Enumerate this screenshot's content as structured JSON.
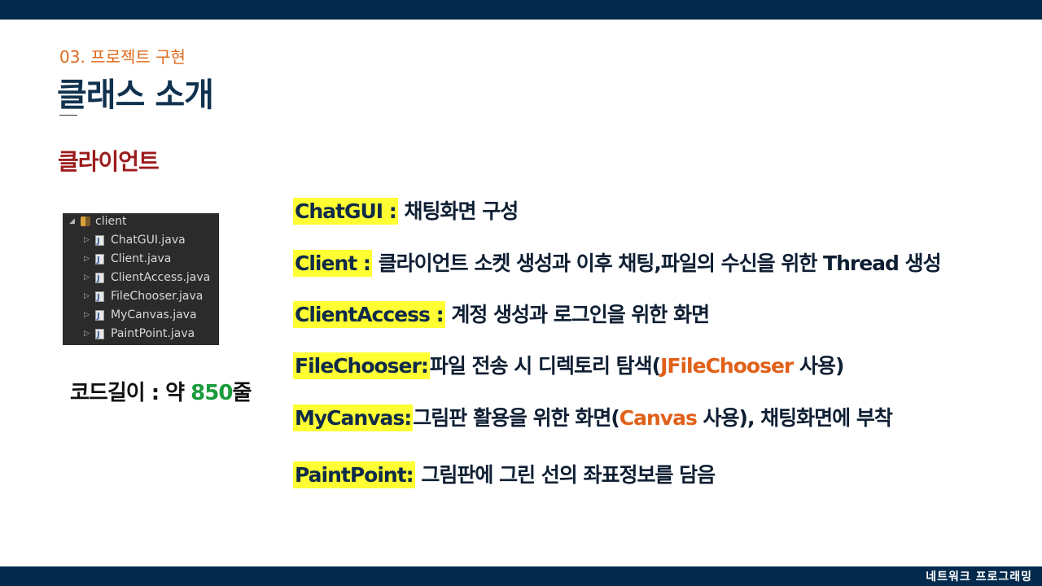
{
  "header": {
    "section_label": "03. 프로젝트 구현",
    "title": "클래스 소개"
  },
  "subsection": "클라이언트",
  "tree": {
    "root": "client",
    "files": [
      "ChatGUI.java",
      "Client.java",
      "ClientAccess.java",
      "FileChooser.java",
      "MyCanvas.java",
      "PaintPoint.java"
    ]
  },
  "code_length": {
    "label": "코드길이 : 약 ",
    "number": "850",
    "unit": "줄"
  },
  "classes": [
    {
      "name": "ChatGUI :",
      "desc": " 채팅화면 구성"
    },
    {
      "name": "Client :",
      "desc": " 클라이언트 소켓 생성과 이후 채팅,파일의 수신을 위한 Thread 생성"
    },
    {
      "name": "ClientAccess :",
      "desc": " 계정 생성과 로그인을 위한 화면"
    },
    {
      "name": "FileChooser:",
      "desc_before": "파일 전송 시 디렉토리 탐색(",
      "highlight": "JFileChooser",
      "desc_after": " 사용)"
    },
    {
      "name": "MyCanvas:",
      "desc_before": "그림판 활용을 위한 화면(",
      "highlight": "Canvas",
      "desc_after": " 사용), 채팅화면에 부착"
    },
    {
      "name": "PaintPoint:",
      "desc": " 그림판에 그린 선의  좌표정보를 담음"
    }
  ],
  "footer": {
    "text": "네트워크 프로그래밍"
  },
  "colors": {
    "navy_bar": "#032a4d",
    "orange": "#e06a1b",
    "dark_red": "#9b1c1c",
    "highlight_yellow": "#ffff33",
    "green": "#1a9c3c"
  }
}
